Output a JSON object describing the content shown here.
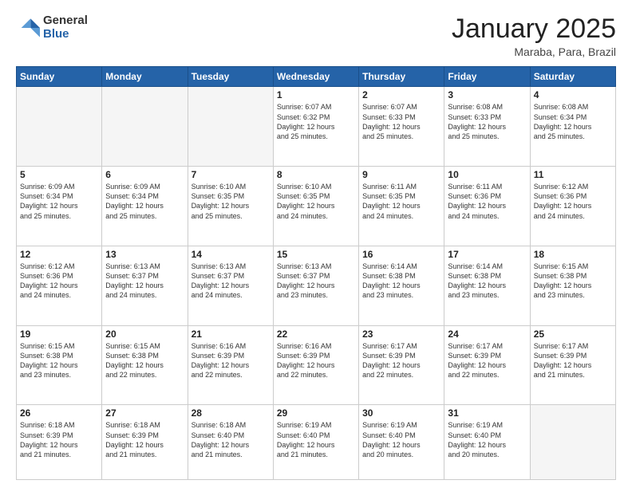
{
  "header": {
    "logo_general": "General",
    "logo_blue": "Blue",
    "month_title": "January 2025",
    "location": "Maraba, Para, Brazil"
  },
  "weekdays": [
    "Sunday",
    "Monday",
    "Tuesday",
    "Wednesday",
    "Thursday",
    "Friday",
    "Saturday"
  ],
  "weeks": [
    [
      {
        "day": "",
        "info": ""
      },
      {
        "day": "",
        "info": ""
      },
      {
        "day": "",
        "info": ""
      },
      {
        "day": "1",
        "info": "Sunrise: 6:07 AM\nSunset: 6:32 PM\nDaylight: 12 hours\nand 25 minutes."
      },
      {
        "day": "2",
        "info": "Sunrise: 6:07 AM\nSunset: 6:33 PM\nDaylight: 12 hours\nand 25 minutes."
      },
      {
        "day": "3",
        "info": "Sunrise: 6:08 AM\nSunset: 6:33 PM\nDaylight: 12 hours\nand 25 minutes."
      },
      {
        "day": "4",
        "info": "Sunrise: 6:08 AM\nSunset: 6:34 PM\nDaylight: 12 hours\nand 25 minutes."
      }
    ],
    [
      {
        "day": "5",
        "info": "Sunrise: 6:09 AM\nSunset: 6:34 PM\nDaylight: 12 hours\nand 25 minutes."
      },
      {
        "day": "6",
        "info": "Sunrise: 6:09 AM\nSunset: 6:34 PM\nDaylight: 12 hours\nand 25 minutes."
      },
      {
        "day": "7",
        "info": "Sunrise: 6:10 AM\nSunset: 6:35 PM\nDaylight: 12 hours\nand 25 minutes."
      },
      {
        "day": "8",
        "info": "Sunrise: 6:10 AM\nSunset: 6:35 PM\nDaylight: 12 hours\nand 24 minutes."
      },
      {
        "day": "9",
        "info": "Sunrise: 6:11 AM\nSunset: 6:35 PM\nDaylight: 12 hours\nand 24 minutes."
      },
      {
        "day": "10",
        "info": "Sunrise: 6:11 AM\nSunset: 6:36 PM\nDaylight: 12 hours\nand 24 minutes."
      },
      {
        "day": "11",
        "info": "Sunrise: 6:12 AM\nSunset: 6:36 PM\nDaylight: 12 hours\nand 24 minutes."
      }
    ],
    [
      {
        "day": "12",
        "info": "Sunrise: 6:12 AM\nSunset: 6:36 PM\nDaylight: 12 hours\nand 24 minutes."
      },
      {
        "day": "13",
        "info": "Sunrise: 6:13 AM\nSunset: 6:37 PM\nDaylight: 12 hours\nand 24 minutes."
      },
      {
        "day": "14",
        "info": "Sunrise: 6:13 AM\nSunset: 6:37 PM\nDaylight: 12 hours\nand 24 minutes."
      },
      {
        "day": "15",
        "info": "Sunrise: 6:13 AM\nSunset: 6:37 PM\nDaylight: 12 hours\nand 23 minutes."
      },
      {
        "day": "16",
        "info": "Sunrise: 6:14 AM\nSunset: 6:38 PM\nDaylight: 12 hours\nand 23 minutes."
      },
      {
        "day": "17",
        "info": "Sunrise: 6:14 AM\nSunset: 6:38 PM\nDaylight: 12 hours\nand 23 minutes."
      },
      {
        "day": "18",
        "info": "Sunrise: 6:15 AM\nSunset: 6:38 PM\nDaylight: 12 hours\nand 23 minutes."
      }
    ],
    [
      {
        "day": "19",
        "info": "Sunrise: 6:15 AM\nSunset: 6:38 PM\nDaylight: 12 hours\nand 23 minutes."
      },
      {
        "day": "20",
        "info": "Sunrise: 6:15 AM\nSunset: 6:38 PM\nDaylight: 12 hours\nand 22 minutes."
      },
      {
        "day": "21",
        "info": "Sunrise: 6:16 AM\nSunset: 6:39 PM\nDaylight: 12 hours\nand 22 minutes."
      },
      {
        "day": "22",
        "info": "Sunrise: 6:16 AM\nSunset: 6:39 PM\nDaylight: 12 hours\nand 22 minutes."
      },
      {
        "day": "23",
        "info": "Sunrise: 6:17 AM\nSunset: 6:39 PM\nDaylight: 12 hours\nand 22 minutes."
      },
      {
        "day": "24",
        "info": "Sunrise: 6:17 AM\nSunset: 6:39 PM\nDaylight: 12 hours\nand 22 minutes."
      },
      {
        "day": "25",
        "info": "Sunrise: 6:17 AM\nSunset: 6:39 PM\nDaylight: 12 hours\nand 21 minutes."
      }
    ],
    [
      {
        "day": "26",
        "info": "Sunrise: 6:18 AM\nSunset: 6:39 PM\nDaylight: 12 hours\nand 21 minutes."
      },
      {
        "day": "27",
        "info": "Sunrise: 6:18 AM\nSunset: 6:39 PM\nDaylight: 12 hours\nand 21 minutes."
      },
      {
        "day": "28",
        "info": "Sunrise: 6:18 AM\nSunset: 6:40 PM\nDaylight: 12 hours\nand 21 minutes."
      },
      {
        "day": "29",
        "info": "Sunrise: 6:19 AM\nSunset: 6:40 PM\nDaylight: 12 hours\nand 21 minutes."
      },
      {
        "day": "30",
        "info": "Sunrise: 6:19 AM\nSunset: 6:40 PM\nDaylight: 12 hours\nand 20 minutes."
      },
      {
        "day": "31",
        "info": "Sunrise: 6:19 AM\nSunset: 6:40 PM\nDaylight: 12 hours\nand 20 minutes."
      },
      {
        "day": "",
        "info": ""
      }
    ]
  ]
}
